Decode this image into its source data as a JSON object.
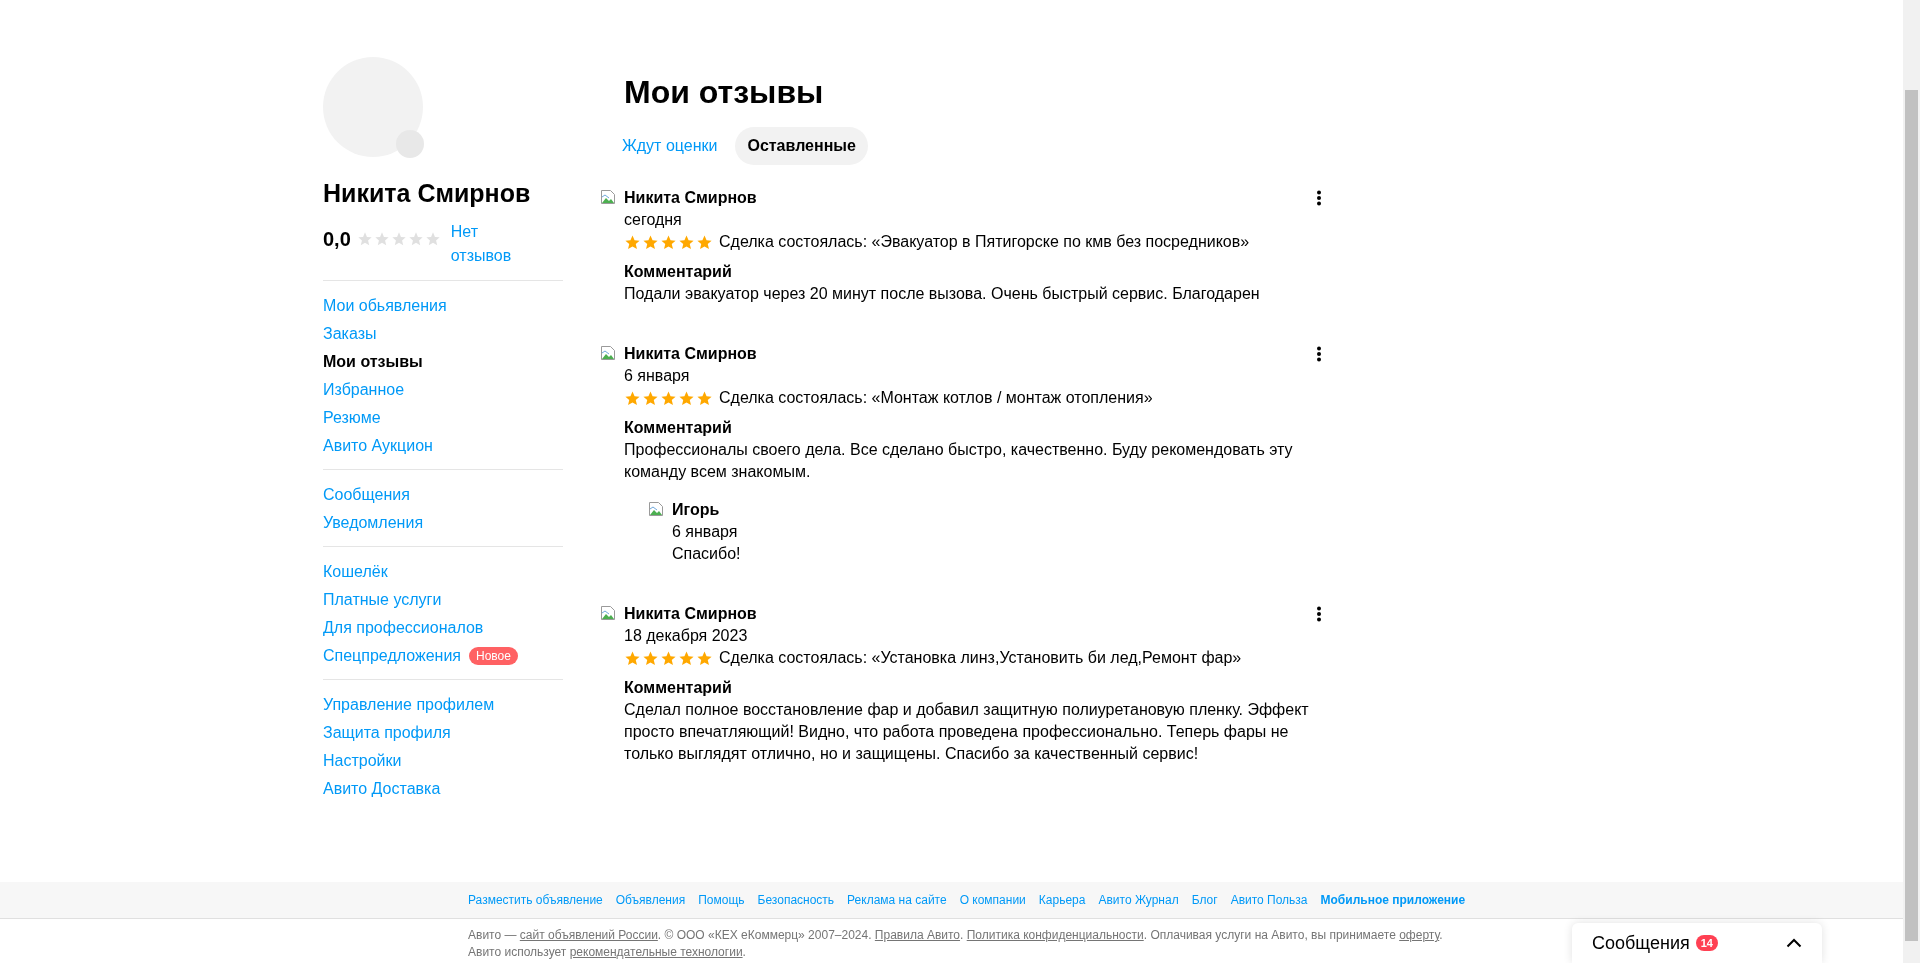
{
  "profile": {
    "name": "Никита Смирнов",
    "rating": "0,0",
    "stars": 0,
    "reviews_link": "Нет отзывов"
  },
  "sidebar": {
    "groups": [
      {
        "items": [
          {
            "label": "Мои обьявления",
            "selected": false
          },
          {
            "label": "Заказы",
            "selected": false
          },
          {
            "label": "Мои отзывы",
            "selected": true
          },
          {
            "label": "Избранное",
            "selected": false
          },
          {
            "label": "Резюме",
            "selected": false
          },
          {
            "label": "Авито Аукцион",
            "selected": false
          }
        ]
      },
      {
        "items": [
          {
            "label": "Сообщения",
            "selected": false
          },
          {
            "label": "Уведомления",
            "selected": false
          }
        ]
      },
      {
        "items": [
          {
            "label": "Кошелёк",
            "selected": false
          },
          {
            "label": "Платные услуги",
            "selected": false
          },
          {
            "label": "Для профессионалов",
            "selected": false
          },
          {
            "label": "Спецпредложения",
            "selected": false,
            "badge": "Новое"
          }
        ]
      },
      {
        "items": [
          {
            "label": "Управление профилем",
            "selected": false
          },
          {
            "label": "Защита профиля",
            "selected": false
          },
          {
            "label": "Настройки",
            "selected": false
          },
          {
            "label": "Авито Доставка",
            "selected": false
          }
        ]
      }
    ]
  },
  "page_title": "Мои отзывы",
  "tabs": [
    {
      "label": "Ждут оценки",
      "selected": false
    },
    {
      "label": "Оставленные",
      "selected": true
    }
  ],
  "reviews": [
    {
      "author": "Никита Смирнов",
      "date": "сегодня",
      "stars": 5,
      "deal": "Сделка состоялась: «Эвакуатор в Пятигорске по кмв без посредников»",
      "comment_label": "Комментарий",
      "comment": "Подали эвакуатор через 20 минут после вызова. Очень быстрый сервис. Благодарен"
    },
    {
      "author": "Никита Смирнов",
      "date": "6 января",
      "stars": 5,
      "deal": "Сделка состоялась: «Монтаж котлов / монтаж отопления»",
      "comment_label": "Комментарий",
      "comment": "Профессионалы своего дела. Все сделано быстро, качественно. Буду рекомендовать эту команду всем знакомым.",
      "reply": {
        "author": "Игорь",
        "date": "6 января",
        "text": "Спасибо!"
      }
    },
    {
      "author": "Никита Смирнов",
      "date": "18 декабря 2023",
      "stars": 5,
      "deal": "Сделка состоялась: «Установка линз,Установить би лед,Ремонт фар»",
      "comment_label": "Комментарий",
      "comment": "Сделал полное восстановление фар и добавил защитную полиуретановую пленку. Эффект просто впечатляющий! Видно, что работа проведена профессионально. Теперь фары не только выглядят отлично, но и защищены. Спасибо за качественный сервис!"
    }
  ],
  "footer": {
    "links": [
      {
        "label": "Разместить объявление",
        "bold": false
      },
      {
        "label": "Объявления",
        "bold": false
      },
      {
        "label": "Помощь",
        "bold": false
      },
      {
        "label": "Безопасность",
        "bold": false
      },
      {
        "label": "Реклама на сайте",
        "bold": false
      },
      {
        "label": "О компании",
        "bold": false
      },
      {
        "label": "Карьера",
        "bold": false
      },
      {
        "label": "Авито Журнал",
        "bold": false
      },
      {
        "label": "Блог",
        "bold": false
      },
      {
        "label": "Авито Польза",
        "bold": false
      },
      {
        "label": "Мобильное приложение",
        "bold": true
      }
    ],
    "legal": [
      {
        "text": "Авито — ",
        "link": false
      },
      {
        "text": "сайт объявлений России",
        "link": true
      },
      {
        "text": ". © ООО «КЕХ еКоммерц» 2007–2024. ",
        "link": false
      },
      {
        "text": "Правила Авито",
        "link": true
      },
      {
        "text": ". ",
        "link": false
      },
      {
        "text": "Политика конфиденциальности",
        "link": true
      },
      {
        "text": ". Оплачивая услуги на Авито, вы принимаете ",
        "link": false
      },
      {
        "text": "оферту",
        "link": true
      },
      {
        "text": ". Авито использует ",
        "link": false
      },
      {
        "text": "рекомендательные технологии",
        "link": true
      },
      {
        "text": ".",
        "link": false
      }
    ]
  },
  "messages_widget": {
    "label": "Сообщения",
    "count": "14"
  }
}
